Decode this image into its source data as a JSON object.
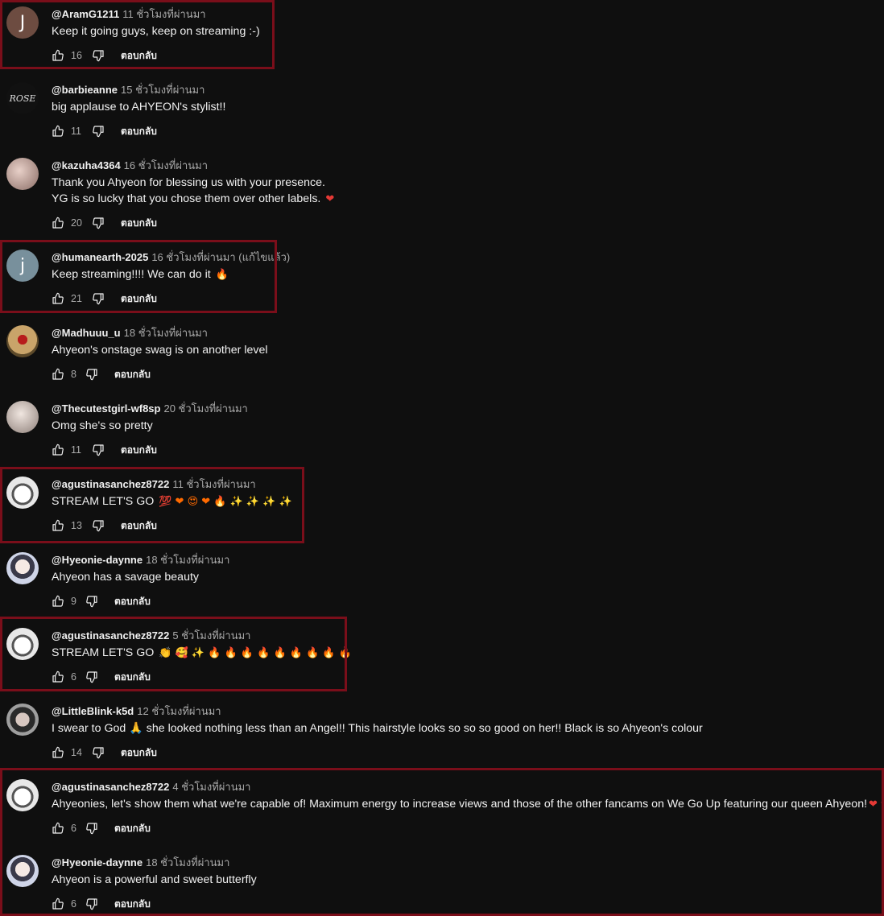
{
  "reply_label": "ตอบกลับ",
  "colors": {
    "background": "#0f0f0f",
    "highlight_border": "#7a0e1a",
    "heart": "#e53935",
    "fire": "#ff6a00"
  },
  "comments": [
    {
      "author": "@AramG1211",
      "time": "11 ชั่วโมงที่ผ่านมา",
      "line1": "Keep it going guys, keep on streaming  :-)",
      "line2": "",
      "emoji": "",
      "likes": "16",
      "avatar_letter": "J",
      "avatar_color": "#6d4c41"
    },
    {
      "author": "@barbieanne",
      "time": "15 ชั่วโมงที่ผ่านมา",
      "line1": "big applause to AHYEON's stylist!!",
      "line2": "",
      "emoji": "",
      "likes": "11",
      "avatar_letter": "ROSE",
      "avatar_color": "#111111"
    },
    {
      "author": "@kazuha4364",
      "time": "16 ชั่วโมงที่ผ่านมา",
      "line1": "Thank you Ahyeon for blessing us with your presence.",
      "line2": "YG is so lucky that you chose them over other labels.",
      "emoji": "❤",
      "likes": "20",
      "avatar_letter": "",
      "avatar_color": "#b99a8f"
    },
    {
      "author": "@humanearth-2025",
      "time": "16 ชั่วโมงที่ผ่านมา (แก้ไขแล้ว)",
      "line1": "Keep streaming!!!! We can do it",
      "line2": "",
      "emoji": "🔥",
      "likes": "21",
      "avatar_letter": "j",
      "avatar_color": "#78909c"
    },
    {
      "author": "@Madhuuu_u",
      "time": "18 ชั่วโมงที่ผ่านมา",
      "line1": "Ahyeon's onstage swag is on another level",
      "line2": "",
      "emoji": "",
      "likes": "8",
      "avatar_letter": "",
      "avatar_color": "#8d6e3f"
    },
    {
      "author": "@Thecutestgirl-wf8sp",
      "time": "20 ชั่วโมงที่ผ่านมา",
      "line1": "Omg she's so pretty",
      "line2": "",
      "emoji": "",
      "likes": "11",
      "avatar_letter": "",
      "avatar_color": "#cfc6c2"
    },
    {
      "author": "@agustinasanchez8722",
      "time": "11 ชั่วโมงที่ผ่านมา",
      "line1": "STREAM LET'S GO",
      "line2": "",
      "emoji": "💯 ❤ 😍 ❤ 🔥 ✨ ✨ ✨ ✨",
      "likes": "13",
      "avatar_letter": "",
      "avatar_color": "#e8e8e8"
    },
    {
      "author": "@Hyeonie-daynne",
      "time": "18 ชั่วโมงที่ผ่านมา",
      "line1": "Ahyeon has a savage beauty",
      "line2": "",
      "emoji": "",
      "likes": "9",
      "avatar_letter": "",
      "avatar_color": "#cfd5e8"
    },
    {
      "author": "@agustinasanchez8722",
      "time": "5 ชั่วโมงที่ผ่านมา",
      "line1": "STREAM LET'S GO",
      "line2": "",
      "emoji": "👏 🥰 ✨ 🔥 🔥 🔥 🔥 🔥 🔥 🔥 🔥 🔥",
      "likes": "6",
      "avatar_letter": "",
      "avatar_color": "#e8e8e8"
    },
    {
      "author": "@LittleBlink-k5d",
      "time": "12 ชั่วโมงที่ผ่านมา",
      "line1": "I swear to God 🙏 she looked nothing less than an Angel!! This hairstyle looks so so so good on her!! Black is so Ahyeon's colour",
      "line2": "",
      "emoji": "",
      "likes": "14",
      "avatar_letter": "",
      "avatar_color": "#9e9e9e"
    },
    {
      "author": "@agustinasanchez8722",
      "time": "4 ชั่วโมงที่ผ่านมา",
      "line1": "Ahyeonies, let's show them what we're capable of! Maximum energy to increase views and those of the other fancams on We Go Up featuring our queen Ahyeon!",
      "line2": "",
      "emoji": "❤ ❤",
      "likes": "6",
      "avatar_letter": "",
      "avatar_color": "#e8e8e8"
    },
    {
      "author": "@Hyeonie-daynne",
      "time": "18 ชั่วโมงที่ผ่านมา",
      "line1": "Ahyeon is a powerful and sweet butterfly",
      "line2": "",
      "emoji": "",
      "likes": "6",
      "avatar_letter": "",
      "avatar_color": "#cfd5e8"
    }
  ]
}
